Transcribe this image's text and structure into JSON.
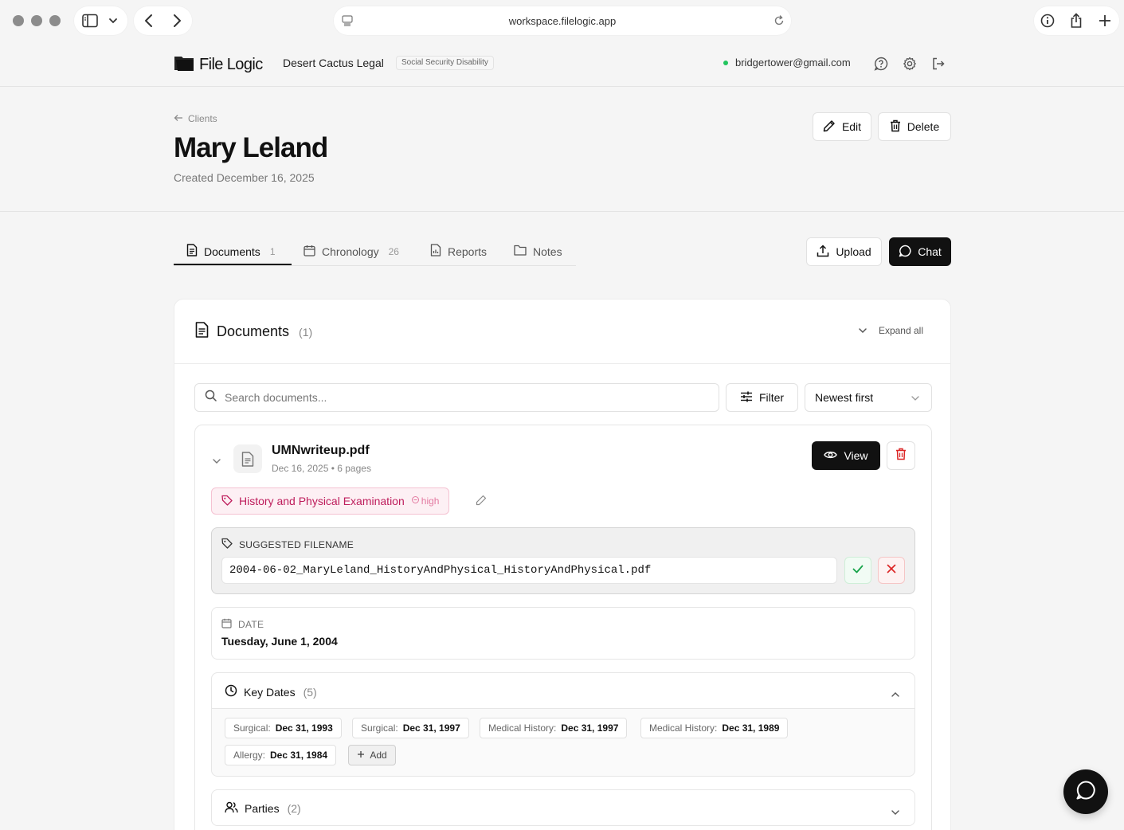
{
  "browser": {
    "url": "workspace.filelogic.app"
  },
  "header": {
    "logo_text": "File Logic",
    "org_name": "Desert Cactus Legal",
    "org_badge": "Social Security Disability",
    "user_email": "bridgertower@gmail.com",
    "status_color": "#22c55e"
  },
  "page": {
    "breadcrumb": "Clients",
    "title": "Mary Leland",
    "created": "Created December 16, 2025",
    "edit_label": "Edit",
    "delete_label": "Delete"
  },
  "tabs": [
    {
      "label": "Documents",
      "count": "1",
      "icon": "document-icon",
      "active": true
    },
    {
      "label": "Chronology",
      "count": "26",
      "icon": "calendar-icon"
    },
    {
      "label": "Reports",
      "count": "",
      "icon": "report-icon"
    },
    {
      "label": "Notes",
      "count": "",
      "icon": "folder-icon"
    }
  ],
  "actions": {
    "upload_label": "Upload",
    "chat_label": "Chat"
  },
  "documents_panel": {
    "title": "Documents",
    "count": "(1)",
    "expand_label": "Expand all",
    "search_placeholder": "Search documents...",
    "filter_label": "Filter",
    "sort_value": "Newest first"
  },
  "document": {
    "name": "UMNwriteup.pdf",
    "meta": "Dec 16, 2025 • 6 pages",
    "view_label": "View",
    "tag_label": "History and Physical Examination",
    "tag_confidence": "high",
    "tag_color": "#be1d5c",
    "suggested_label": "SUGGESTED FILENAME",
    "suggested_filename": "2004-06-02_MaryLeland_HistoryAndPhysical_HistoryAndPhysical.pdf",
    "date_label": "DATE",
    "date_value": "Tuesday, June 1, 2004",
    "key_dates_title": "Key Dates",
    "key_dates_count": "(5)",
    "key_dates": [
      {
        "label": "Surgical:",
        "value": "Dec 31, 1993"
      },
      {
        "label": "Surgical:",
        "value": "Dec 31, 1997"
      },
      {
        "label": "Medical History:",
        "value": "Dec 31, 1997"
      },
      {
        "label": "Medical History:",
        "value": "Dec 31, 1989"
      },
      {
        "label": "Allergy:",
        "value": "Dec 31, 1984"
      }
    ],
    "add_label": "Add",
    "parties_title": "Parties",
    "parties_count": "(2)"
  }
}
